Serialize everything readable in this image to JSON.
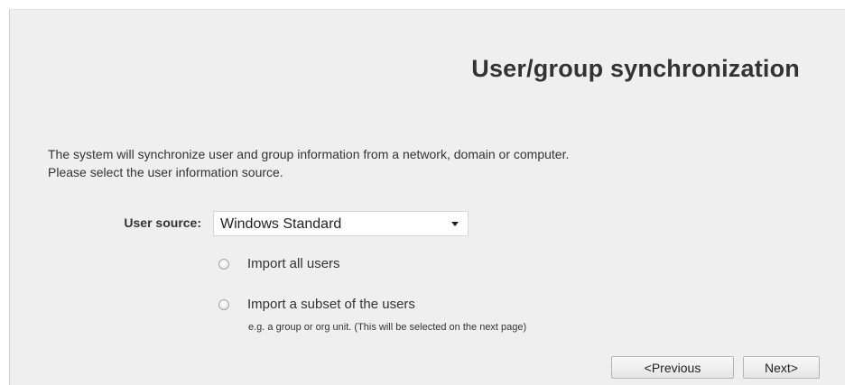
{
  "page": {
    "title": "User/group synchronization",
    "intro_line1": "The system will synchronize user and group information from a network, domain or computer.",
    "intro_line2": "Please select the user information source."
  },
  "user_source": {
    "label": "User source:",
    "selected": "Windows Standard"
  },
  "options": [
    {
      "label": "Import all users",
      "checked": false
    },
    {
      "label": "Import a subset of the users",
      "checked": false
    }
  ],
  "hint": "e.g. a group or org unit. (This will be selected on the next page)",
  "buttons": {
    "previous": "<Previous",
    "next": "Next>"
  },
  "colors": {
    "panel_background": "#efefef",
    "text": "#333333",
    "button_border": "#b4b4b4"
  },
  "icons": {
    "select_arrow": "chevron-down-icon",
    "radio": "radio-button"
  }
}
